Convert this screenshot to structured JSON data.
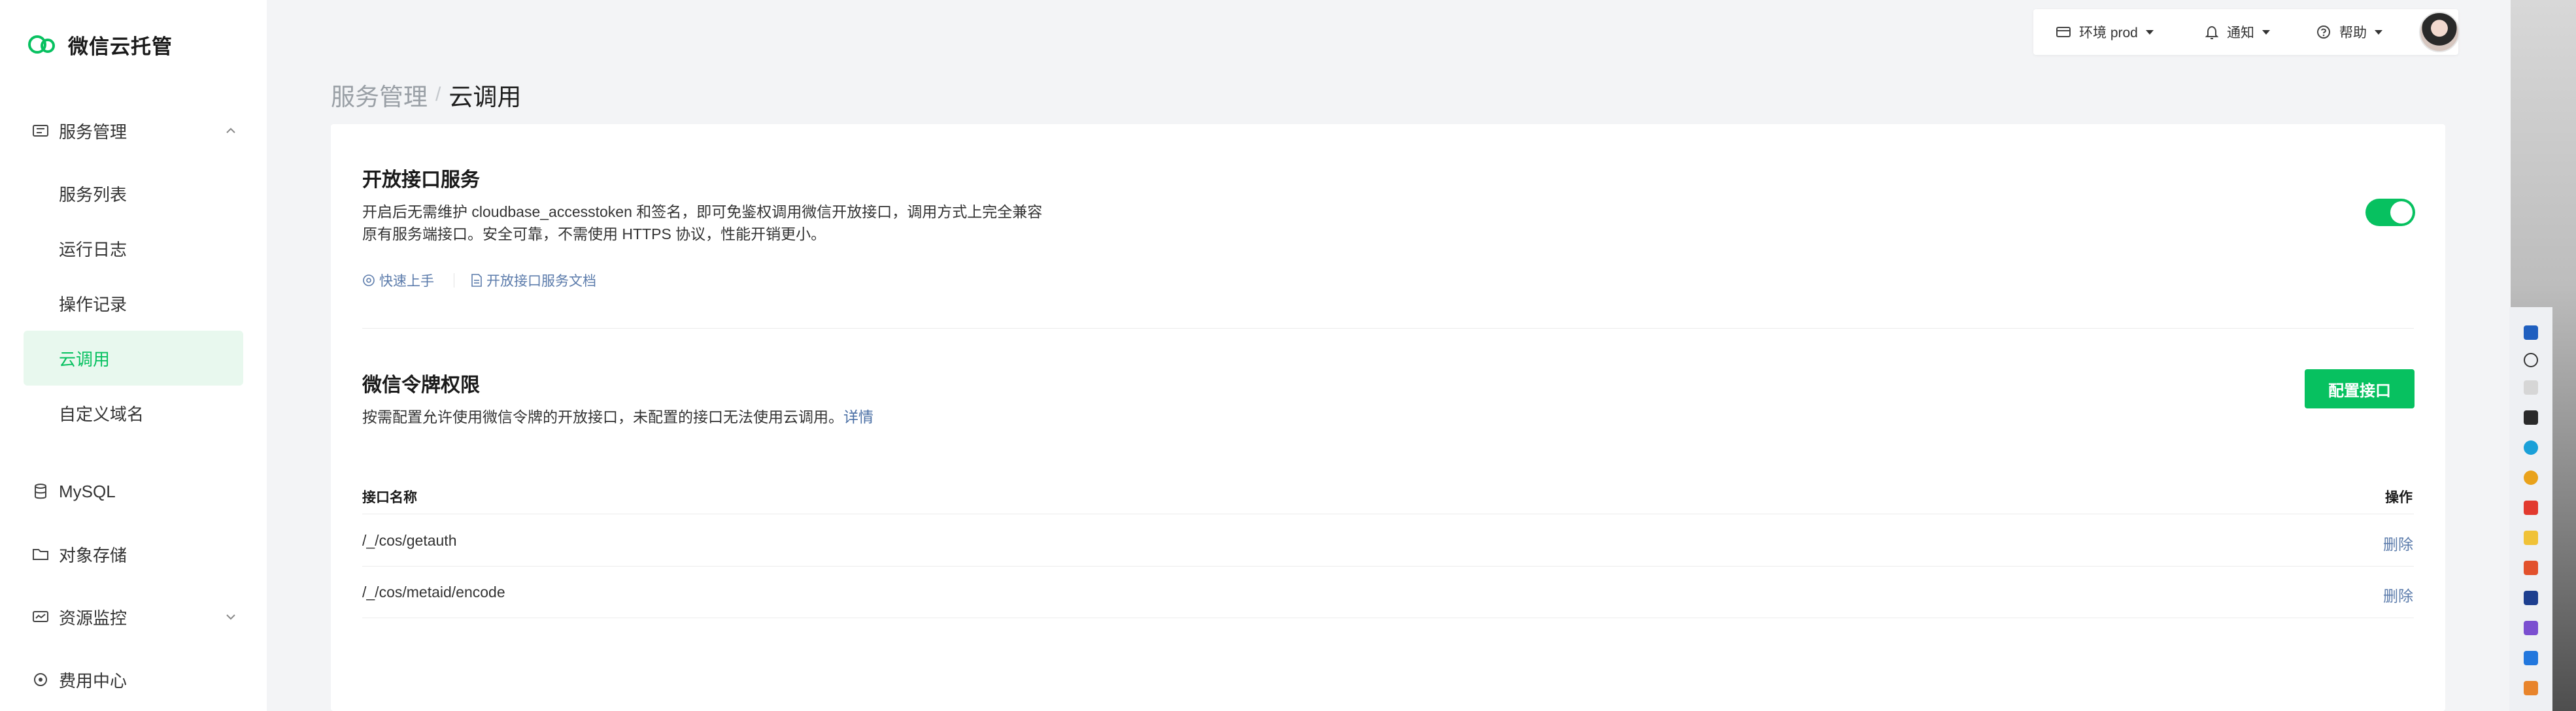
{
  "app": {
    "title": "微信云托管"
  },
  "sidebar": {
    "groups": [
      {
        "label": "服务管理",
        "icon": "service-icon"
      },
      {
        "label": "MySQL",
        "icon": "database-icon"
      },
      {
        "label": "对象存储",
        "icon": "folder-icon"
      },
      {
        "label": "资源监控",
        "icon": "monitor-icon"
      },
      {
        "label": "费用中心",
        "icon": "billing-icon"
      }
    ],
    "service_items": [
      "服务列表",
      "运行日志",
      "操作记录",
      "云调用",
      "自定义域名"
    ],
    "active_item": "云调用"
  },
  "topbar": {
    "env_label": "环境 prod",
    "notify_label": "通知",
    "help_label": "帮助"
  },
  "breadcrumb": {
    "parent": "服务管理",
    "separator": "/",
    "current": "云调用"
  },
  "open_api": {
    "title": "开放接口服务",
    "desc_line1": "开启后无需维护 cloudbase_accesstoken 和签名，即可免鉴权调用微信开放接口，调用方式上完全兼容",
    "desc_line2": "原有服务端接口。安全可靠，不需使用 HTTPS 协议，性能开销更小。",
    "quick_start": "快速上手",
    "docs": "开放接口服务文档",
    "enabled": true
  },
  "token_perm": {
    "title": "微信令牌权限",
    "desc": "按需配置允许使用微信令牌的开放接口，未配置的接口无法使用云调用。",
    "detail_link": "详情",
    "config_button": "配置接口"
  },
  "table": {
    "col_name": "接口名称",
    "col_action": "操作",
    "rows": [
      {
        "name": "/_/cos/getauth",
        "action": "删除"
      },
      {
        "name": "/_/cos/metaid/encode",
        "action": "删除"
      }
    ]
  },
  "colors": {
    "accent": "#07c160",
    "link": "#5b7bab",
    "active_bg": "#e8f8ee"
  }
}
